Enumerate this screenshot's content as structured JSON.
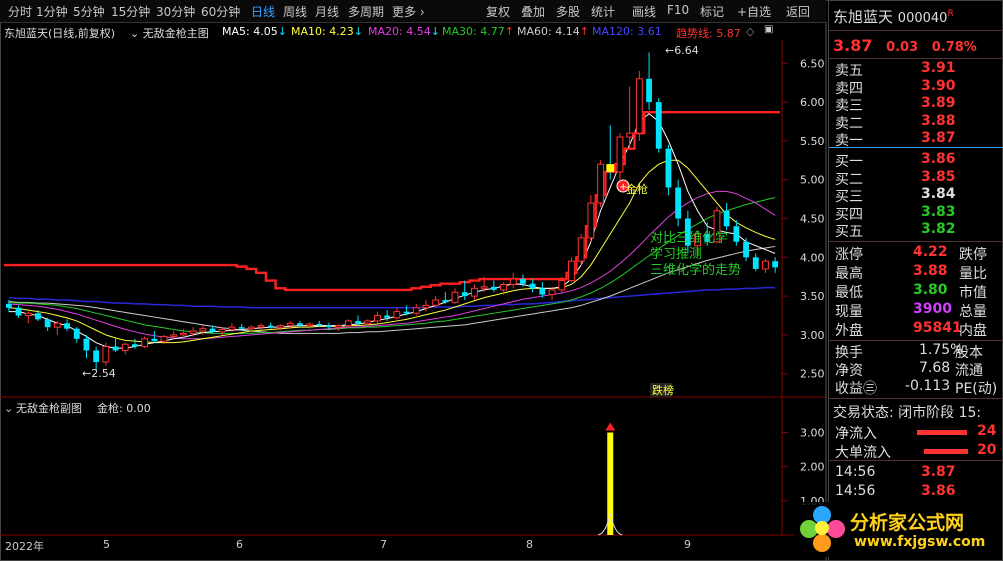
{
  "toolbar": {
    "periods": [
      "分时",
      "1分钟",
      "5分钟",
      "15分钟",
      "30分钟",
      "60分钟",
      "日线",
      "周线",
      "月线",
      "多周期",
      "更多"
    ],
    "active_period": "日线",
    "tools": [
      "复权",
      "叠加",
      "多股",
      "统计",
      "画线",
      "F10",
      "标记",
      "+自选",
      "返回"
    ]
  },
  "legend": {
    "title": "东旭蓝天(日线,前复权)",
    "indicator": "无敌金枪主图",
    "ma5": "MA5: 4.05",
    "ma10": "MA10: 4.23",
    "ma20": "MA20: 4.54",
    "ma30": "MA30: 4.77",
    "ma60": "MA60: 4.14",
    "ma120": "MA120: 3.61",
    "trend": "趋势线: 5.87"
  },
  "subchart": {
    "title": "无敌金枪副图",
    "value": "金枪: 0.00"
  },
  "annotations": {
    "high": "6.64",
    "low": "2.54",
    "jinqiang": "金枪",
    "dieting": "跌榜",
    "note": [
      "对比三维化学",
      "学习推测",
      "三维化学的走势"
    ]
  },
  "xaxis": {
    "labels": [
      "2022年",
      "5",
      "6",
      "7",
      "8",
      "9"
    ]
  },
  "quote": {
    "name": "东旭蓝天",
    "code": "000040",
    "flag": "R",
    "price": "3.87",
    "change": "0.03",
    "pct": "0.78%",
    "asks": [
      [
        "卖五",
        "3.91"
      ],
      [
        "卖四",
        "3.90"
      ],
      [
        "卖三",
        "3.89"
      ],
      [
        "卖二",
        "3.88"
      ],
      [
        "卖一",
        "3.87"
      ]
    ],
    "bids": [
      [
        "买一",
        "3.86"
      ],
      [
        "买二",
        "3.85"
      ],
      [
        "买三",
        "3.84"
      ],
      [
        "买四",
        "3.83"
      ],
      [
        "买五",
        "3.82"
      ]
    ],
    "stats": [
      [
        "涨停",
        "4.22",
        "跌停"
      ],
      [
        "最高",
        "3.88",
        "量比"
      ],
      [
        "最低",
        "3.80",
        "市值"
      ],
      [
        "现量",
        "3900",
        "总量"
      ],
      [
        "外盘",
        "95841",
        "内盘"
      ]
    ],
    "stats2": [
      [
        "换手",
        "1.75%",
        "股本"
      ],
      [
        "净资",
        "7.68",
        "流通"
      ],
      [
        "收益㊂",
        "-0.113",
        "PE(动)"
      ]
    ],
    "status": "交易状态: 闭市阶段 15:",
    "flows": [
      [
        "净流入",
        "24"
      ],
      [
        "大单流入",
        "20"
      ]
    ],
    "ticks": [
      [
        "14:56",
        "3.87"
      ],
      [
        "14:56",
        "3.86"
      ]
    ]
  },
  "watermark": {
    "cn": "分析家公式网",
    "url": "www.fxjgsw.com"
  },
  "colors": {
    "up": "#ff3232",
    "down": "#00e4ff",
    "ma5": "#ffffff",
    "ma10": "#ffff3c",
    "ma20": "#e040e0",
    "ma30": "#28c828",
    "ma60": "#cccccc",
    "ma120": "#2828d8",
    "trend": "#ff2020",
    "signal": "#ffff00"
  },
  "chart_data": {
    "type": "candlestick",
    "y_main": {
      "ticks": [
        2.5,
        3.0,
        3.5,
        4.0,
        4.5,
        5.0,
        5.5,
        6.0,
        6.5
      ],
      "range": [
        2.2,
        6.8
      ]
    },
    "y_sub": {
      "ticks": [
        1.0,
        2.0,
        3.0
      ],
      "range": [
        0,
        3.6
      ]
    },
    "ohlc": [
      [
        3.4,
        3.45,
        3.3,
        3.35
      ],
      [
        3.35,
        3.38,
        3.22,
        3.25
      ],
      [
        3.25,
        3.3,
        3.15,
        3.28
      ],
      [
        3.28,
        3.32,
        3.18,
        3.2
      ],
      [
        3.2,
        3.22,
        3.05,
        3.1
      ],
      [
        3.1,
        3.18,
        3.0,
        3.15
      ],
      [
        3.15,
        3.2,
        3.05,
        3.08
      ],
      [
        3.08,
        3.1,
        2.9,
        2.95
      ],
      [
        2.95,
        3.0,
        2.7,
        2.8
      ],
      [
        2.8,
        2.85,
        2.54,
        2.65
      ],
      [
        2.65,
        2.9,
        2.6,
        2.85
      ],
      [
        2.85,
        2.95,
        2.78,
        2.8
      ],
      [
        2.8,
        2.9,
        2.75,
        2.88
      ],
      [
        2.88,
        2.95,
        2.82,
        2.85
      ],
      [
        2.85,
        2.98,
        2.83,
        2.95
      ],
      [
        2.95,
        3.05,
        2.9,
        2.92
      ],
      [
        2.92,
        3.0,
        2.88,
        2.98
      ],
      [
        2.98,
        3.05,
        2.94,
        3.0
      ],
      [
        3.0,
        3.08,
        2.95,
        3.02
      ],
      [
        3.02,
        3.1,
        2.98,
        3.05
      ],
      [
        3.05,
        3.12,
        3.0,
        3.08
      ],
      [
        3.08,
        3.12,
        3.02,
        3.04
      ],
      [
        3.04,
        3.1,
        3.0,
        3.07
      ],
      [
        3.07,
        3.15,
        3.04,
        3.1
      ],
      [
        3.1,
        3.14,
        3.05,
        3.08
      ],
      [
        3.08,
        3.12,
        3.03,
        3.1
      ],
      [
        3.1,
        3.15,
        3.06,
        3.12
      ],
      [
        3.12,
        3.16,
        3.08,
        3.1
      ],
      [
        3.1,
        3.14,
        3.06,
        3.12
      ],
      [
        3.12,
        3.18,
        3.08,
        3.15
      ],
      [
        3.15,
        3.18,
        3.1,
        3.12
      ],
      [
        3.12,
        3.16,
        3.08,
        3.14
      ],
      [
        3.14,
        3.18,
        3.1,
        3.12
      ],
      [
        3.12,
        3.16,
        3.06,
        3.1
      ],
      [
        3.1,
        3.14,
        3.05,
        3.12
      ],
      [
        3.12,
        3.2,
        3.1,
        3.18
      ],
      [
        3.18,
        3.25,
        3.12,
        3.15
      ],
      [
        3.15,
        3.2,
        3.1,
        3.18
      ],
      [
        3.18,
        3.3,
        3.15,
        3.25
      ],
      [
        3.25,
        3.32,
        3.18,
        3.22
      ],
      [
        3.22,
        3.35,
        3.2,
        3.3
      ],
      [
        3.3,
        3.38,
        3.25,
        3.28
      ],
      [
        3.28,
        3.4,
        3.25,
        3.35
      ],
      [
        3.35,
        3.45,
        3.3,
        3.38
      ],
      [
        3.38,
        3.5,
        3.35,
        3.45
      ],
      [
        3.45,
        3.55,
        3.4,
        3.42
      ],
      [
        3.42,
        3.6,
        3.4,
        3.55
      ],
      [
        3.55,
        3.7,
        3.45,
        3.5
      ],
      [
        3.5,
        3.65,
        3.45,
        3.6
      ],
      [
        3.6,
        3.75,
        3.55,
        3.62
      ],
      [
        3.62,
        3.7,
        3.55,
        3.58
      ],
      [
        3.58,
        3.68,
        3.52,
        3.65
      ],
      [
        3.65,
        3.8,
        3.6,
        3.72
      ],
      [
        3.72,
        3.78,
        3.62,
        3.66
      ],
      [
        3.66,
        3.72,
        3.55,
        3.6
      ],
      [
        3.6,
        3.68,
        3.48,
        3.52
      ],
      [
        3.52,
        3.62,
        3.45,
        3.58
      ],
      [
        3.58,
        3.75,
        3.55,
        3.7
      ],
      [
        3.7,
        4.0,
        3.68,
        3.95
      ],
      [
        3.95,
        4.3,
        3.9,
        4.25
      ],
      [
        4.25,
        4.8,
        4.2,
        4.7
      ],
      [
        4.7,
        5.25,
        4.65,
        5.2
      ],
      [
        5.2,
        5.7,
        5.0,
        5.1
      ],
      [
        5.1,
        5.6,
        5.0,
        5.55
      ],
      [
        5.55,
        6.2,
        5.4,
        5.6
      ],
      [
        5.6,
        6.4,
        5.5,
        6.3
      ],
      [
        6.3,
        6.64,
        5.9,
        6.0
      ],
      [
        6.0,
        6.05,
        5.35,
        5.4
      ],
      [
        5.4,
        5.45,
        4.8,
        4.9
      ],
      [
        4.9,
        5.0,
        4.4,
        4.5
      ],
      [
        4.5,
        4.6,
        4.05,
        4.15
      ],
      [
        4.15,
        4.35,
        4.0,
        4.3
      ],
      [
        4.3,
        4.45,
        4.15,
        4.2
      ],
      [
        4.2,
        4.65,
        4.18,
        4.6
      ],
      [
        4.6,
        4.7,
        4.35,
        4.4
      ],
      [
        4.4,
        4.48,
        4.15,
        4.2
      ],
      [
        4.2,
        4.25,
        3.95,
        4.0
      ],
      [
        4.0,
        4.05,
        3.82,
        3.85
      ],
      [
        3.85,
        3.98,
        3.8,
        3.95
      ],
      [
        3.95,
        4.0,
        3.8,
        3.87
      ]
    ],
    "ma": {
      "ma5": [
        3.3,
        3.3,
        3.27,
        3.25,
        3.2,
        3.15,
        3.12,
        3.05,
        2.98,
        2.9,
        2.85,
        2.83,
        2.83,
        2.85,
        2.88,
        2.9,
        2.92,
        2.95,
        2.97,
        3.0,
        3.03,
        3.04,
        3.05,
        3.06,
        3.07,
        3.08,
        3.09,
        3.1,
        3.1,
        3.11,
        3.12,
        3.12,
        3.12,
        3.12,
        3.12,
        3.13,
        3.14,
        3.16,
        3.19,
        3.21,
        3.24,
        3.27,
        3.3,
        3.34,
        3.38,
        3.42,
        3.47,
        3.51,
        3.55,
        3.58,
        3.6,
        3.63,
        3.66,
        3.65,
        3.62,
        3.6,
        3.6,
        3.62,
        3.72,
        3.9,
        4.2,
        4.6,
        4.9,
        5.2,
        5.45,
        5.75,
        5.85,
        5.75,
        5.5,
        5.2,
        4.85,
        4.6,
        4.4,
        4.35,
        4.32,
        4.3,
        4.2,
        4.15,
        4.1,
        4.05
      ],
      "ma10": [
        3.35,
        3.34,
        3.32,
        3.3,
        3.28,
        3.25,
        3.22,
        3.18,
        3.12,
        3.06,
        3.0,
        2.96,
        2.93,
        2.92,
        2.91,
        2.9,
        2.9,
        2.9,
        2.91,
        2.93,
        2.95,
        2.97,
        2.99,
        3.01,
        3.03,
        3.05,
        3.06,
        3.07,
        3.08,
        3.09,
        3.1,
        3.1,
        3.11,
        3.11,
        3.11,
        3.12,
        3.12,
        3.13,
        3.14,
        3.16,
        3.18,
        3.2,
        3.23,
        3.26,
        3.29,
        3.32,
        3.36,
        3.4,
        3.44,
        3.48,
        3.51,
        3.54,
        3.57,
        3.59,
        3.6,
        3.6,
        3.6,
        3.61,
        3.65,
        3.75,
        3.9,
        4.1,
        4.3,
        4.5,
        4.7,
        4.95,
        5.1,
        5.2,
        5.25,
        5.25,
        5.15,
        5.0,
        4.85,
        4.7,
        4.55,
        4.45,
        4.38,
        4.32,
        4.27,
        4.23
      ],
      "ma20": [
        3.4,
        3.39,
        3.38,
        3.37,
        3.35,
        3.33,
        3.3,
        3.27,
        3.23,
        3.19,
        3.15,
        3.11,
        3.07,
        3.04,
        3.01,
        2.99,
        2.97,
        2.96,
        2.95,
        2.95,
        2.95,
        2.96,
        2.97,
        2.98,
        2.99,
        3.0,
        3.01,
        3.02,
        3.03,
        3.04,
        3.05,
        3.06,
        3.07,
        3.08,
        3.09,
        3.1,
        3.1,
        3.11,
        3.12,
        3.13,
        3.14,
        3.15,
        3.17,
        3.19,
        3.21,
        3.23,
        3.25,
        3.28,
        3.31,
        3.34,
        3.37,
        3.4,
        3.43,
        3.46,
        3.48,
        3.5,
        3.52,
        3.54,
        3.57,
        3.61,
        3.67,
        3.74,
        3.82,
        3.92,
        4.03,
        4.15,
        4.28,
        4.4,
        4.52,
        4.62,
        4.7,
        4.77,
        4.82,
        4.85,
        4.85,
        4.82,
        4.76,
        4.7,
        4.62,
        4.54
      ],
      "ma30": [
        3.42,
        3.41,
        3.41,
        3.4,
        3.39,
        3.38,
        3.36,
        3.34,
        3.31,
        3.28,
        3.25,
        3.22,
        3.19,
        3.16,
        3.13,
        3.11,
        3.09,
        3.07,
        3.05,
        3.04,
        3.03,
        3.02,
        3.02,
        3.02,
        3.02,
        3.02,
        3.03,
        3.03,
        3.04,
        3.05,
        3.06,
        3.06,
        3.07,
        3.07,
        3.08,
        3.09,
        3.09,
        3.1,
        3.1,
        3.11,
        3.12,
        3.13,
        3.14,
        3.15,
        3.17,
        3.18,
        3.2,
        3.22,
        3.24,
        3.26,
        3.28,
        3.3,
        3.32,
        3.34,
        3.36,
        3.38,
        3.4,
        3.42,
        3.45,
        3.49,
        3.54,
        3.6,
        3.67,
        3.75,
        3.84,
        3.93,
        4.02,
        4.11,
        4.2,
        4.28,
        4.36,
        4.43,
        4.5,
        4.56,
        4.6,
        4.64,
        4.68,
        4.71,
        4.74,
        4.77
      ],
      "ma60": [
        3.43,
        3.42,
        3.42,
        3.41,
        3.41,
        3.4,
        3.39,
        3.38,
        3.37,
        3.35,
        3.33,
        3.31,
        3.29,
        3.27,
        3.25,
        3.23,
        3.21,
        3.19,
        3.17,
        3.15,
        3.13,
        3.11,
        3.09,
        3.08,
        3.06,
        3.05,
        3.04,
        3.03,
        3.02,
        3.02,
        3.02,
        3.02,
        3.02,
        3.02,
        3.02,
        3.03,
        3.03,
        3.04,
        3.04,
        3.05,
        3.06,
        3.07,
        3.08,
        3.09,
        3.1,
        3.11,
        3.12,
        3.13,
        3.15,
        3.17,
        3.19,
        3.21,
        3.23,
        3.25,
        3.27,
        3.29,
        3.31,
        3.33,
        3.35,
        3.38,
        3.42,
        3.46,
        3.5,
        3.55,
        3.6,
        3.65,
        3.7,
        3.75,
        3.8,
        3.84,
        3.88,
        3.92,
        3.96,
        3.99,
        4.02,
        4.05,
        4.08,
        4.1,
        4.12,
        4.14
      ],
      "ma120": [
        3.48,
        3.47,
        3.47,
        3.46,
        3.46,
        3.45,
        3.45,
        3.44,
        3.43,
        3.43,
        3.42,
        3.41,
        3.41,
        3.4,
        3.4,
        3.39,
        3.39,
        3.38,
        3.38,
        3.37,
        3.37,
        3.37,
        3.36,
        3.36,
        3.36,
        3.35,
        3.35,
        3.35,
        3.35,
        3.35,
        3.35,
        3.35,
        3.35,
        3.35,
        3.35,
        3.35,
        3.35,
        3.35,
        3.35,
        3.35,
        3.35,
        3.35,
        3.35,
        3.36,
        3.36,
        3.36,
        3.36,
        3.37,
        3.37,
        3.38,
        3.38,
        3.39,
        3.39,
        3.4,
        3.4,
        3.41,
        3.42,
        3.43,
        3.44,
        3.45,
        3.46,
        3.47,
        3.48,
        3.49,
        3.5,
        3.51,
        3.52,
        3.53,
        3.54,
        3.55,
        3.56,
        3.57,
        3.58,
        3.58,
        3.59,
        3.59,
        3.6,
        3.6,
        3.61,
        3.61
      ],
      "trend": [
        3.9,
        3.9,
        3.9,
        3.9,
        3.9,
        3.9,
        3.9,
        3.9,
        3.9,
        3.9,
        3.9,
        3.9,
        3.9,
        3.9,
        3.9,
        3.9,
        3.9,
        3.9,
        3.9,
        3.9,
        3.9,
        3.9,
        3.9,
        3.9,
        3.88,
        3.85,
        3.8,
        3.7,
        3.6,
        3.58,
        3.58,
        3.58,
        3.58,
        3.58,
        3.58,
        3.58,
        3.58,
        3.58,
        3.58,
        3.58,
        3.58,
        3.58,
        3.6,
        3.62,
        3.64,
        3.66,
        3.66,
        3.68,
        3.7,
        3.72,
        3.72,
        3.72,
        3.72,
        3.72,
        3.72,
        3.72,
        3.72,
        3.72,
        3.8,
        4.0,
        4.4,
        4.8,
        5.1,
        5.2,
        5.4,
        5.6,
        5.87,
        5.87,
        5.87,
        5.87,
        5.87,
        5.87,
        5.87,
        5.87,
        5.87,
        5.87,
        5.87,
        5.87,
        5.87,
        5.87
      ]
    },
    "signal": {
      "index": 63,
      "value": 3.0
    }
  }
}
